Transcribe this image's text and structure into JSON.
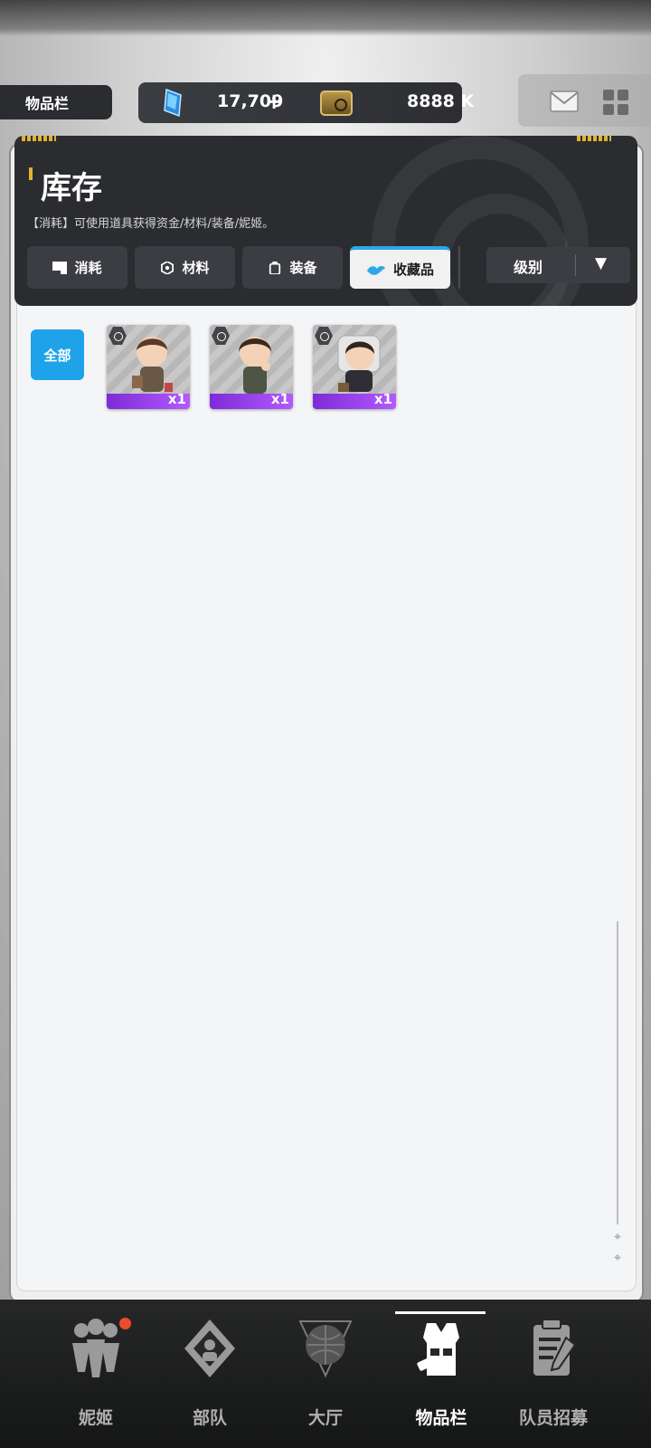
{
  "header": {
    "page_tab": "物品栏",
    "gem_count": "17,709",
    "gem_plus": "+",
    "gold_count": "8888 K"
  },
  "inventory": {
    "title": "库存",
    "subtitle": "【消耗】可使用道具获得资金/材料/装备/妮姬。",
    "tabs": [
      {
        "label": "消耗",
        "active": false
      },
      {
        "label": "材料",
        "active": false
      },
      {
        "label": "装备",
        "active": false
      },
      {
        "label": "收藏品",
        "active": true
      }
    ],
    "sort_label": "级别",
    "sort_arrow": "▼",
    "filter_all": "全部",
    "items": [
      {
        "qty": "x1",
        "rarity_color": "#9b45f0"
      },
      {
        "qty": "x1",
        "rarity_color": "#9b45f0"
      },
      {
        "qty": "x1",
        "rarity_color": "#9b45f0"
      }
    ]
  },
  "nav": {
    "items": [
      {
        "label": "妮姬",
        "icon": "squad-people-icon"
      },
      {
        "label": "部队",
        "icon": "team-cards-icon"
      },
      {
        "label": "大厅",
        "icon": "globe-icon"
      },
      {
        "label": "物品栏",
        "icon": "vest-icon",
        "active": true
      },
      {
        "label": "队员招募",
        "icon": "clipboard-icon"
      }
    ]
  },
  "colors": {
    "accent_blue": "#1ea3ea",
    "accent_yellow": "#e1b234",
    "notification_red": "#ed4c2c",
    "rarity_purple": "#9b45f0"
  }
}
